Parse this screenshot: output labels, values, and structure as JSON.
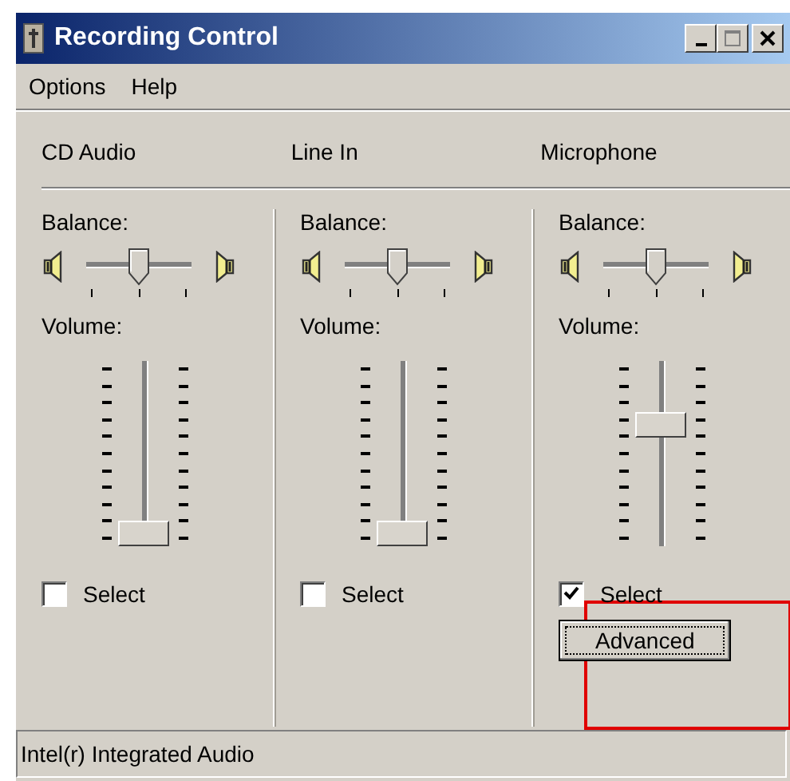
{
  "window": {
    "title": "Recording Control"
  },
  "menu": [
    {
      "label": "Options"
    },
    {
      "label": "Help"
    }
  ],
  "channels": [
    {
      "name": "CD Audio",
      "balance_label": "Balance:",
      "balance": {
        "level": 0.5
      },
      "volume_label": "Volume:",
      "volume": {
        "level": 0.0
      },
      "select": {
        "label": "Select",
        "checked": false
      }
    },
    {
      "name": "Line In",
      "balance_label": "Balance:",
      "balance": {
        "level": 0.5
      },
      "volume_label": "Volume:",
      "volume": {
        "level": 0.0
      },
      "select": {
        "label": "Select",
        "checked": false
      }
    },
    {
      "name": "Microphone",
      "balance_label": "Balance:",
      "balance": {
        "level": 0.5
      },
      "volume_label": "Volume:",
      "volume": {
        "level": 0.68
      },
      "select": {
        "label": "Select",
        "checked": true
      },
      "advanced_button": "Advanced"
    }
  ],
  "status_bar": "Intel(r) Integrated Audio"
}
